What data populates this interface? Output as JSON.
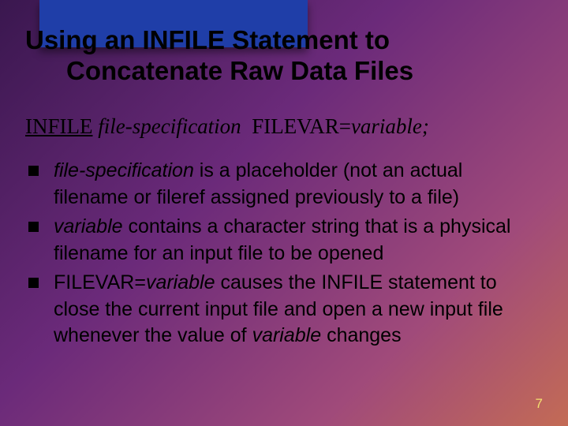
{
  "title": {
    "line1": "Using an INFILE Statement to",
    "line2": "Concatenate Raw Data Files"
  },
  "syntax": {
    "infile": "INFILE",
    "filespec": "file-specification",
    "filevar_kw": "FILEVAR=",
    "filevar_var": "variable;"
  },
  "bullets": [
    {
      "term": "file-specification",
      "rest": " is a placeholder (not an actual filename or fileref assigned previously to a file)"
    },
    {
      "term": "variable ",
      "rest": " contains a character string that is a physical filename for an input file to be opened"
    },
    {
      "prefix": "FILEVAR=",
      "mid_italic": "variable",
      "mid_plain": " causes the INFILE statement to close the current input file and open a new input file whenever the value of ",
      "tail_italic": "variable",
      "tail_plain": " changes"
    }
  ],
  "page_number": "7"
}
